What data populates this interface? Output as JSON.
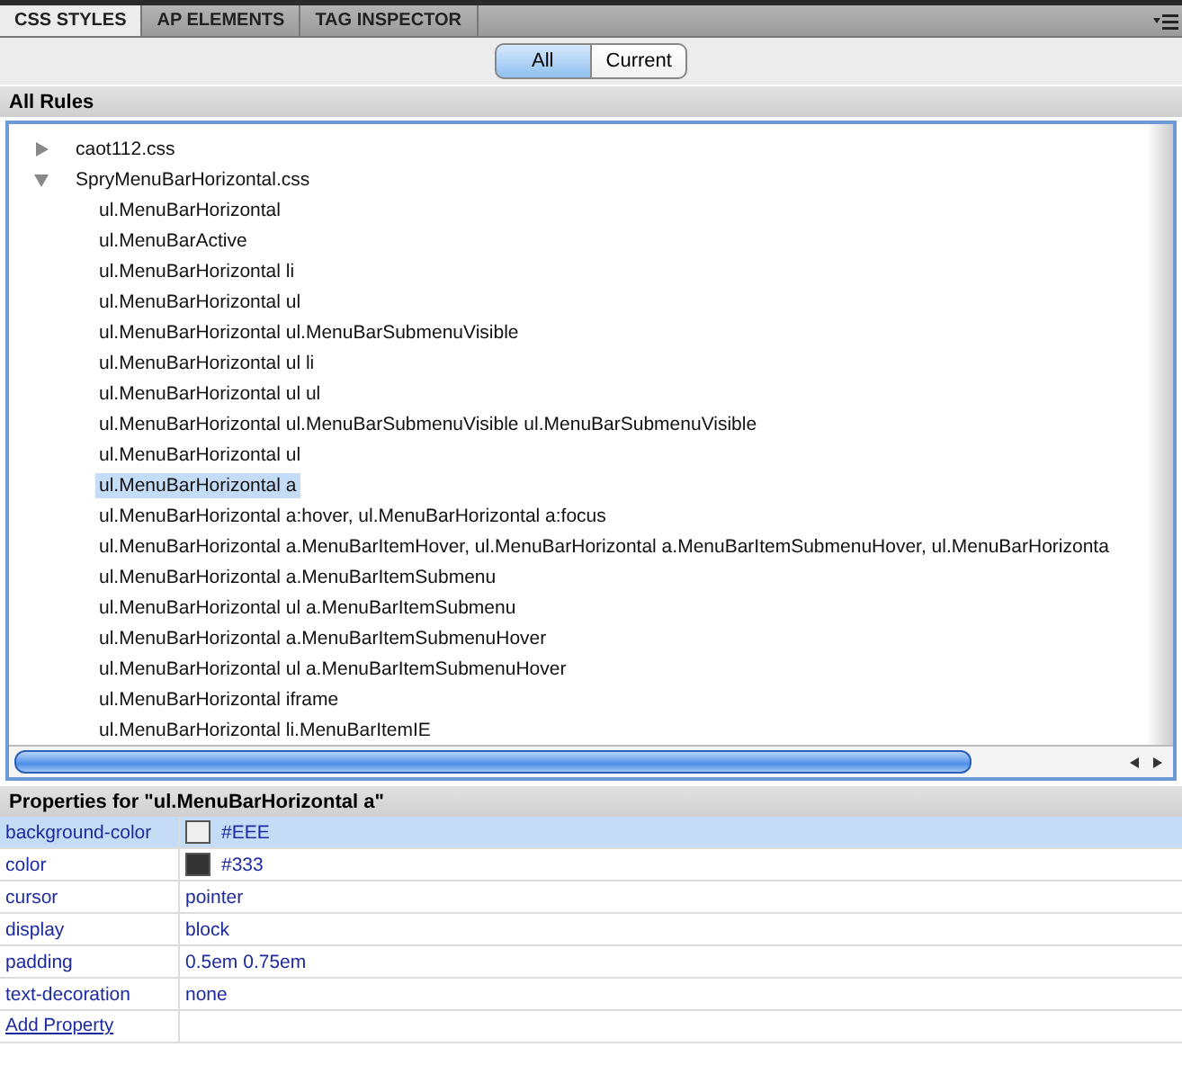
{
  "tabs": [
    {
      "label": "CSS STYLES",
      "selected": true
    },
    {
      "label": "AP ELEMENTS",
      "selected": false
    },
    {
      "label": "TAG INSPECTOR",
      "selected": false
    }
  ],
  "mode_toggle": [
    {
      "label": "All",
      "selected": true
    },
    {
      "label": "Current",
      "selected": false
    }
  ],
  "rules_header": "All Rules",
  "rules_tree": [
    {
      "label": "caot112.css",
      "expanded": false
    },
    {
      "label": "SpryMenuBarHorizontal.css",
      "expanded": true,
      "children": [
        {
          "label": "ul.MenuBarHorizontal",
          "selected": false
        },
        {
          "label": "ul.MenuBarActive",
          "selected": false
        },
        {
          "label": "ul.MenuBarHorizontal li",
          "selected": false
        },
        {
          "label": "ul.MenuBarHorizontal ul",
          "selected": false
        },
        {
          "label": "ul.MenuBarHorizontal ul.MenuBarSubmenuVisible",
          "selected": false
        },
        {
          "label": "ul.MenuBarHorizontal ul li",
          "selected": false
        },
        {
          "label": "ul.MenuBarHorizontal ul ul",
          "selected": false
        },
        {
          "label": "ul.MenuBarHorizontal ul.MenuBarSubmenuVisible ul.MenuBarSubmenuVisible",
          "selected": false
        },
        {
          "label": "ul.MenuBarHorizontal ul",
          "selected": false
        },
        {
          "label": "ul.MenuBarHorizontal a",
          "selected": true
        },
        {
          "label": "ul.MenuBarHorizontal a:hover, ul.MenuBarHorizontal a:focus",
          "selected": false
        },
        {
          "label": "ul.MenuBarHorizontal a.MenuBarItemHover, ul.MenuBarHorizontal a.MenuBarItemSubmenuHover, ul.MenuBarHorizonta",
          "selected": false
        },
        {
          "label": "ul.MenuBarHorizontal a.MenuBarItemSubmenu",
          "selected": false
        },
        {
          "label": "ul.MenuBarHorizontal ul a.MenuBarItemSubmenu",
          "selected": false
        },
        {
          "label": "ul.MenuBarHorizontal a.MenuBarItemSubmenuHover",
          "selected": false
        },
        {
          "label": "ul.MenuBarHorizontal ul a.MenuBarItemSubmenuHover",
          "selected": false
        },
        {
          "label": "ul.MenuBarHorizontal iframe",
          "selected": false
        },
        {
          "label": "ul.MenuBarHorizontal li.MenuBarItemIE",
          "selected": false
        }
      ]
    }
  ],
  "properties_header": "Properties for \"ul.MenuBarHorizontal a\"",
  "properties": [
    {
      "name": "background-color",
      "value": "#EEE",
      "color": "#eeeeee",
      "selected": true
    },
    {
      "name": "color",
      "value": "#333",
      "color": "#333333",
      "selected": false
    },
    {
      "name": "cursor",
      "value": "pointer",
      "selected": false
    },
    {
      "name": "display",
      "value": "block",
      "selected": false
    },
    {
      "name": "padding",
      "value": "0.5em 0.75em",
      "selected": false
    },
    {
      "name": "text-decoration",
      "value": "none",
      "selected": false
    }
  ],
  "add_property": "Add Property"
}
